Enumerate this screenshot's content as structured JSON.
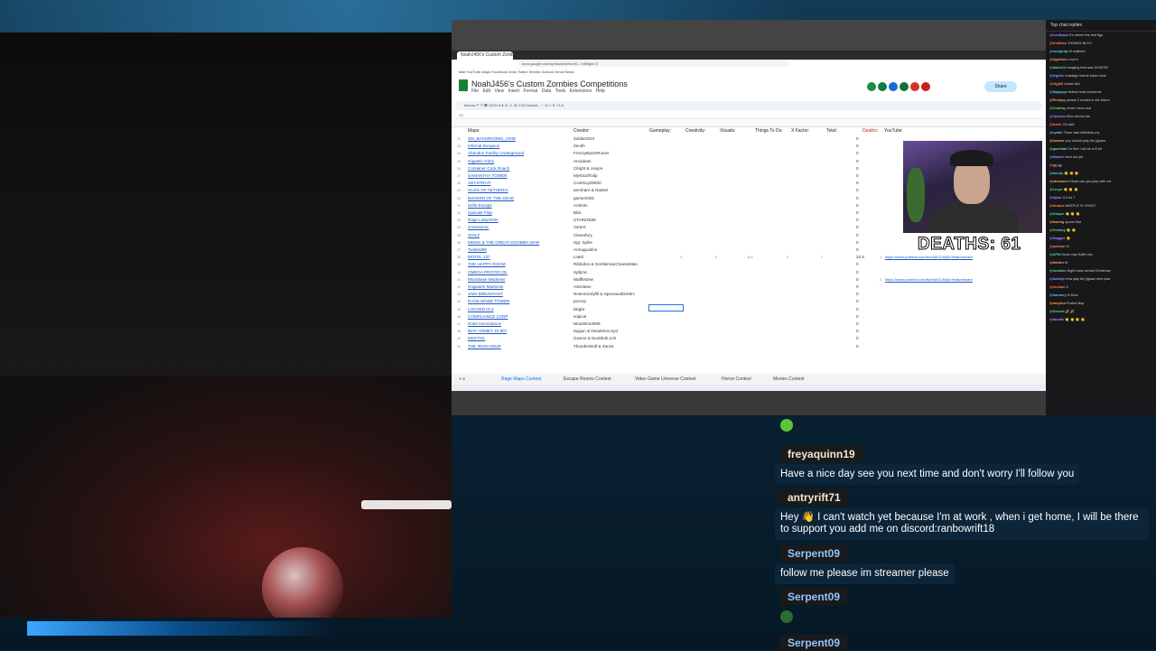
{
  "browser": {
    "tab_title": "NoahJ456's Custom Zombies Competitions",
    "url": "docs.google.com/spreadsheets/d/1...edit#gid=0",
    "bookmarks": "Mail  YouTube  Maps  Facebook  Drive  Twitch  Sheets  Outlook  Gmail  News"
  },
  "sheet": {
    "title": "NoahJ456's Custom Zombies Competitions",
    "menu": "File Edit View Insert Format Data Tools Extensions Help",
    "share_label": "Share",
    "toolbar_text": "Menus  ↶  ↷  🖶  100%  ▾  $  %  .0  .00  123  Default...  −  10  +  B  I  S  A",
    "cell_ref": "G2",
    "headers": {
      "maps": "Maps:",
      "creator": "Creator:",
      "gameplay": "Gameplay:",
      "creativity": "Creativity:",
      "visuals": "Visuals:",
      "things": "Things To Do:",
      "xfactor": "X Factor:",
      "total": "Total:",
      "deaths": "Deaths:",
      "youtube": "YouTube"
    },
    "rows": [
      {
        "num": "22",
        "map": "SM_BACKROOMS_VOID",
        "creator": "Zoldar2024",
        "total": "0"
      },
      {
        "num": "23",
        "map": "Infernal Dungeon",
        "creator": "Zenith",
        "total": "0"
      },
      {
        "num": "24",
        "map": "Abandon Facility Underground",
        "creator": "FrenzyBazerRunes",
        "total": "0"
      },
      {
        "num": "25",
        "map": "Gigantic Glory",
        "creator": "Arcadeas",
        "total": "0"
      },
      {
        "num": "26",
        "map": "Container Cock Roach",
        "creator": "Clright & cesyre",
        "total": "0"
      },
      {
        "num": "27",
        "map": "SAMANTHA TOWER",
        "creator": "MysticalTulip",
        "total": "0"
      },
      {
        "num": "28",
        "map": "ABYSTRAIT",
        "creator": "CoolGuy25830",
        "total": "0"
      },
      {
        "num": "29",
        "map": "ISLES OF AETHERIA",
        "creator": "aerohare & Nastiel",
        "total": "0"
      },
      {
        "num": "30",
        "map": "BUNKER OF THE DEAD",
        "creator": "gamerz025",
        "total": "0"
      },
      {
        "num": "31",
        "map": "Hells Escape",
        "creator": "Anheim",
        "total": "0"
      },
      {
        "num": "32",
        "map": "Upscale Flop",
        "creator": "Blat",
        "total": "0"
      },
      {
        "num": "33",
        "map": "Rage Labyrinthe",
        "creator": "STARZGMK",
        "total": "0"
      },
      {
        "num": "34",
        "map": "Gravesonic",
        "creator": "VorteX",
        "total": "0"
      },
      {
        "num": "35",
        "map": "SHILZ",
        "creator": "Cleverfury",
        "total": "0"
      },
      {
        "num": "36",
        "map": "MEMO & THE GREAT GOOMBA WAR",
        "creator": "Sgt. Spike",
        "total": "0"
      },
      {
        "num": "37",
        "map": "Twisted69",
        "creator": "Armaguddon",
        "total": "0"
      },
      {
        "num": "38",
        "map": "MOTEL 137",
        "creator": "LiaKil",
        "total": "22.5",
        "scores": [
          "3",
          "4",
          "6.5",
          "2",
          "7"
        ],
        "link_num": "1",
        "link": "https://www.youtube.com/live/kaXZ-8rj3o?featureshare"
      },
      {
        "num": "39",
        "map": "THE HAPPY ROOM",
        "creator": "Ribbidoo & GentlemanCheeseMan",
        "total": "0"
      },
      {
        "num": "40",
        "map": "OMEGA PROTOCOL",
        "creator": "Spfymc",
        "total": "0"
      },
      {
        "num": "41",
        "map": "Moonbase Madness",
        "creator": "WaffleDew",
        "total": "0",
        "link_num": "2",
        "link": "https://www.youtube.com/live/kaXZ-8rj3o?featureshare"
      },
      {
        "num": "42",
        "map": "Hogwarts Madness",
        "creator": "Astrolean",
        "total": "0"
      },
      {
        "num": "43",
        "map": "JIMS BREAKFAST",
        "creator": "Nosemicolyfill & SpectaoolDer8rc",
        "total": "0"
      },
      {
        "num": "44",
        "map": "RAGE MODE TOWER",
        "creator": "pocorp",
        "total": "0"
      },
      {
        "num": "45",
        "map": "LOCKED IN 2",
        "creator": "bkight",
        "total": "0"
      },
      {
        "num": "46",
        "map": "COMPLIANCE LOOP",
        "creator": "Ixipical",
        "total": "0"
      },
      {
        "num": "47",
        "map": "Hotel Ascendance",
        "creator": "Woodsmoth99",
        "total": "0"
      },
      {
        "num": "48",
        "map": "IBAY HOMET 23 807",
        "creator": "taygun & Deadshot.mp4",
        "total": "0"
      },
      {
        "num": "49",
        "map": "DESYNC",
        "creator": "Gwens & Noobfork.nch",
        "total": "0"
      },
      {
        "num": "50",
        "map": "THE IRON HOUR",
        "creator": "ThunderWolf & Zanos",
        "total": "0"
      }
    ],
    "tabs": [
      "Rage Maps Contest",
      "Escape Rooms Contest",
      "Video Game Universe Contest",
      "Horror Contest",
      "Movies Contest"
    ]
  },
  "deaths_counter": "DEATHS: 61",
  "mini_chat": {
    "header": "Top chat replies",
    "lines": [
      {
        "u": "@Lordbaux",
        "t": "It's meme the rest lfga"
      },
      {
        "u": "@Kraftbea",
        "t": "THANKS BUYO"
      },
      {
        "u": "@noogtrap",
        "t": "W wallbers"
      },
      {
        "u": "@Zyphens",
        "t": "Love it"
      },
      {
        "u": "@babloCh",
        "t": "imaging that was GOATED"
      },
      {
        "u": "@legbier",
        "t": "nostalgic theme future look"
      },
      {
        "u": "@lrijg98",
        "t": "Llooks like"
      },
      {
        "u": "@Nappaya",
        "t": "bellow noss tomorrow"
      },
      {
        "u": "@Frumpy",
        "t": "please 2 modes in the future"
      },
      {
        "u": "@ChoKay",
        "t": "never mind cool"
      },
      {
        "u": "@Jaxxom",
        "t": "Kind seems fun"
      },
      {
        "u": "@Iceler",
        "t": "Oh well"
      },
      {
        "u": "@zyadh",
        "t": "There was definitely my"
      },
      {
        "u": "@roamer",
        "t": "you should play the jigsaw"
      },
      {
        "u": "@gamblab",
        "t": "I'm fine i will be a lil bit"
      },
      {
        "u": "@Moster",
        "t": "here not yet"
      },
      {
        "u": "@gg",
        "t": "gg"
      },
      {
        "u": "@dondy",
        "t": "👏 👏 👏"
      },
      {
        "u": "@streamerx",
        "t": "Noah can you play with me"
      },
      {
        "u": "@Lurpo",
        "t": "👏 👏 👏"
      },
      {
        "u": "@dylan",
        "t": "3.3 no 7"
      },
      {
        "u": "@ttrabox",
        "t": "WAFFLE IS CRAZY"
      },
      {
        "u": "@Kasper",
        "t": "👏 👏 👏"
      },
      {
        "u": "@fearing",
        "t": "spook that"
      },
      {
        "u": "@Genboy",
        "t": "👏 👏"
      },
      {
        "u": "@Haggee",
        "t": "👏"
      },
      {
        "u": "@pokeprr",
        "t": "hi"
      },
      {
        "u": "@AFM",
        "t": "Good map Kaffe doc"
      },
      {
        "u": "@tntrdm",
        "t": "W"
      },
      {
        "u": "@noobins",
        "t": "Night mare arrival Christmas"
      },
      {
        "u": "@bobbyh",
        "t": "Ima play the jigsaw next year"
      },
      {
        "u": "@rockboi",
        "t": "4"
      },
      {
        "u": "@harmory",
        "t": "It Wins"
      },
      {
        "u": "@meyden",
        "t": "Ended Map"
      },
      {
        "u": "@Desura",
        "t": "🎉 🎉"
      },
      {
        "u": "@doodle",
        "t": "👏 👏 👏 👏"
      }
    ]
  },
  "chat": [
    {
      "user": "freyaquinn19",
      "message": "Have a nice day see you next time and don't worry I'll follow you"
    },
    {
      "user": "antryrift71",
      "message": "Hey 👋 I can't watch yet because I'm at work , when i get home, I will be there to support you add me on discord:ranbowrift18"
    },
    {
      "user": "Serpent09",
      "message": "follow me please im streamer please"
    },
    {
      "user": "Serpent09",
      "message": ""
    },
    {
      "user": "Serpent09",
      "message": ""
    }
  ],
  "colors": {
    "accent": "#1a73e8",
    "sheets_green": "#188038",
    "link": "#1a56c4"
  }
}
